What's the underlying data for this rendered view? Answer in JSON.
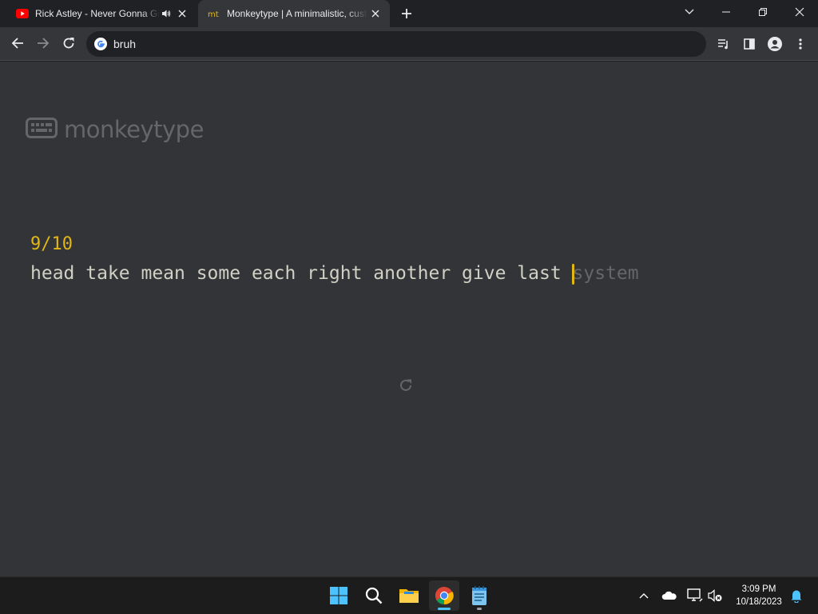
{
  "browser": {
    "tabs": [
      {
        "title": "Rick Astley - Never Gonna Give You Up",
        "favicon": "youtube-icon",
        "audio": true
      },
      {
        "title": "Monkeytype | A minimalistic, customizable typing test",
        "favicon": "mt",
        "active": true
      }
    ],
    "address": "bruh"
  },
  "monkeytype": {
    "logo_text": "monkeytype",
    "word_counter": "9/10",
    "typed_words": "head take mean some each right another give last ",
    "current_word_first": "s",
    "current_word_rest": "ystem",
    "colors": {
      "bg": "#323437",
      "main": "#e2b714",
      "text": "#d1d0c5",
      "sub": "#646669"
    }
  },
  "taskbar": {
    "apps": [
      "windows-start-icon",
      "search-icon",
      "file-explorer-icon",
      "chrome-icon",
      "notepad-icon"
    ],
    "time": "3:09 PM",
    "date": "10/18/2023"
  }
}
